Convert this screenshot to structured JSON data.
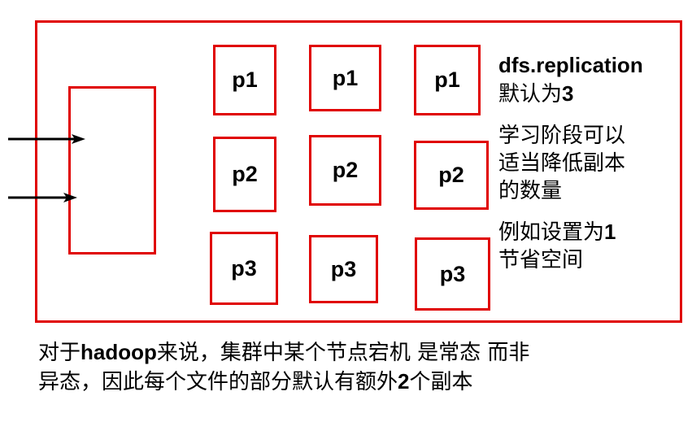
{
  "blocks": {
    "row1": [
      "p1",
      "p1",
      "p1"
    ],
    "row2": [
      "p2",
      "p2",
      "p2"
    ],
    "row3": [
      "p3",
      "p3",
      "p3"
    ]
  },
  "notes": {
    "config_key": "dfs.replication",
    "default_prefix": "默认为",
    "default_value": "3",
    "learning_line1": "学习阶段可以",
    "learning_line2": "适当降低副本",
    "learning_line3": "的数量",
    "example_prefix": "例如设置为",
    "example_value": "1",
    "example_line2": "节省空间"
  },
  "caption": {
    "line1_prefix": "对于",
    "line1_bold": "hadoop",
    "line1_suffix": "来说，集群中某个节点宕机 是常态 而非",
    "line2_prefix": "异态，因此每个文件的部分默认有额外",
    "line2_bold": "2",
    "line2_suffix": "个副本"
  },
  "colors": {
    "frame": "#e00000",
    "text": "#000000",
    "arrow": "#000000"
  }
}
